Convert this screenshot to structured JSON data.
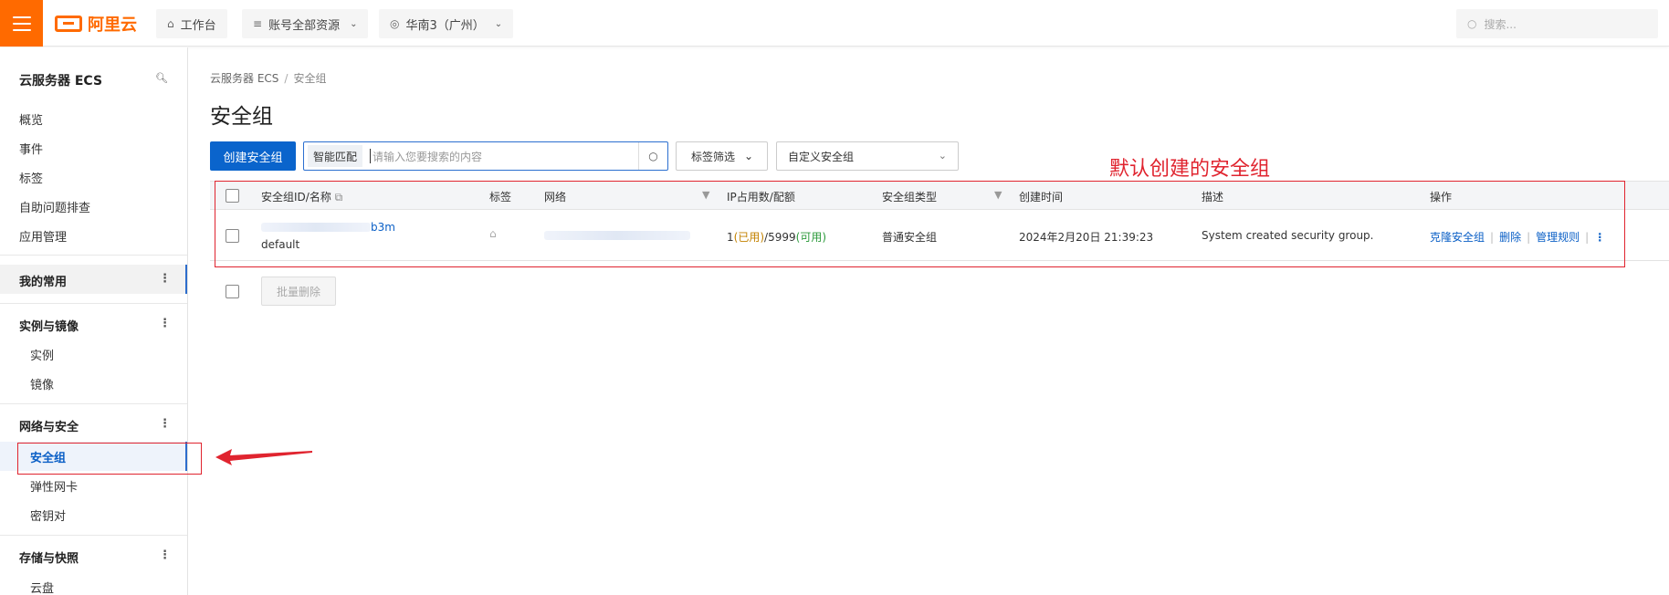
{
  "topbar": {
    "logo_text": "阿里云",
    "workbench": "工作台",
    "resources": "账号全部资源",
    "region": "华南3（广州）",
    "search_placeholder": "搜索..."
  },
  "sidebar": {
    "title": "云服务器 ECS",
    "items": [
      "概览",
      "事件",
      "标签",
      "自助问题排查",
      "应用管理"
    ],
    "favorites": "我的常用",
    "sections": [
      {
        "title": "实例与镜像",
        "items": [
          "实例",
          "镜像"
        ]
      },
      {
        "title": "网络与安全",
        "items": [
          "安全组",
          "弹性网卡",
          "密钥对"
        ]
      },
      {
        "title": "存储与快照",
        "items": [
          "云盘"
        ]
      }
    ]
  },
  "breadcrumb": {
    "root": "云服务器 ECS",
    "sep": "/",
    "current": "安全组"
  },
  "page_title": "安全组",
  "toolbar": {
    "create_button": "创建安全组",
    "search_mode": "智能匹配",
    "search_placeholder": "请输入您要搜索的内容",
    "tag_filter": "标签筛选",
    "select_value": "自定义安全组"
  },
  "table": {
    "columns": [
      "安全组ID/名称",
      "标签",
      "网络",
      "IP占用数/配额",
      "安全组类型",
      "创建时间",
      "描述",
      "操作"
    ],
    "rows": [
      {
        "id_suffix": "b3m",
        "name": "default",
        "ip_used": "1",
        "ip_used_label": "已用",
        "ip_quota": "5999",
        "ip_quota_label": "可用",
        "type": "普通安全组",
        "created": "2024年2月20日 21:39:23",
        "description": "System created security group.",
        "actions": [
          "克隆安全组",
          "删除",
          "管理规则"
        ]
      }
    ]
  },
  "bulk_delete": "批量删除",
  "annotation": {
    "text": "默认创建的安全组",
    "color": "#e0242f"
  },
  "colors": {
    "brand": "#ff6a00",
    "primary": "#0a64cc",
    "link": "#0a5fc6"
  }
}
